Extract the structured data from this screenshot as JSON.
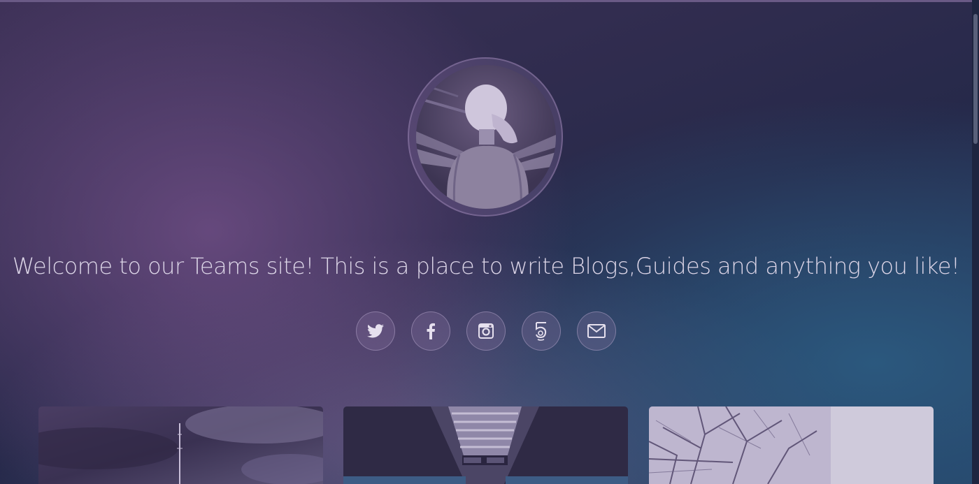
{
  "hero": {
    "tagline": "Welcome to our Teams site! This is a place to write Blogs,Guides and anything you like!"
  },
  "social_links": [
    {
      "icon": "twitter-icon"
    },
    {
      "icon": "facebook-icon"
    },
    {
      "icon": "instagram-icon"
    },
    {
      "icon": "500px-icon"
    },
    {
      "icon": "envelope-icon"
    }
  ],
  "colors": {
    "background_dark": "#232b48",
    "background_purple": "#3d3157",
    "background_blue": "#243d61",
    "text": "#ddd6e8"
  },
  "posts": [
    {
      "image": "antenna-sky-thumbnail"
    },
    {
      "image": "train-station-thumbnail"
    },
    {
      "image": "snowy-tree-thumbnail"
    }
  ]
}
